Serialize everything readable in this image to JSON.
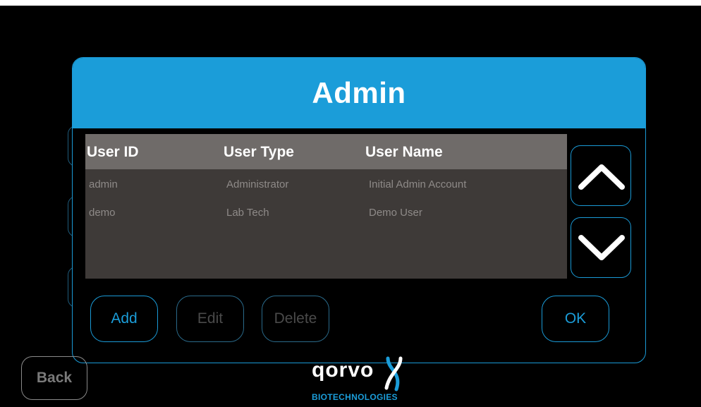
{
  "dialog": {
    "title": "Admin"
  },
  "table": {
    "columns": [
      "User ID",
      "User Type",
      "User Name"
    ],
    "rows": [
      [
        "admin",
        "Administrator",
        "Initial Admin Account"
      ],
      [
        "demo",
        "Lab Tech",
        "Demo User"
      ]
    ]
  },
  "scroll": {
    "up_icon": "chevron-up-icon",
    "down_icon": "chevron-down-icon"
  },
  "actions": {
    "add": "Add",
    "edit": "Edit",
    "delete": "Delete",
    "ok": "OK"
  },
  "nav": {
    "back": "Back"
  },
  "brand": {
    "name": "qorvo",
    "sub": "BIOTECHNOLOGIES",
    "accent": "#1b9dd9"
  }
}
